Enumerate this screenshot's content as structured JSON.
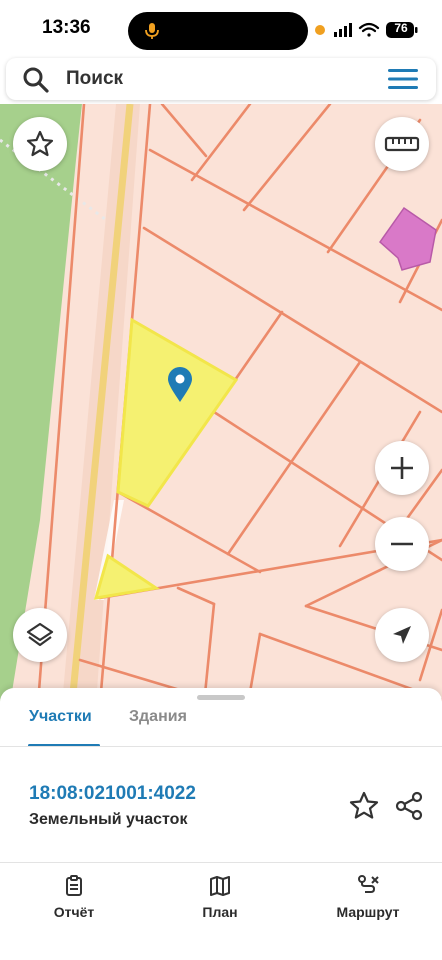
{
  "status_bar": {
    "time": "13:36",
    "battery": "76",
    "icons": [
      "microphone-icon",
      "recording-dot-icon",
      "signal-icon",
      "wifi-icon",
      "battery-icon"
    ]
  },
  "search": {
    "placeholder": "Поиск",
    "icons": [
      "search-icon",
      "menu-icon"
    ]
  },
  "map": {
    "controls": [
      "favorite-star-icon",
      "ruler-icon",
      "layers-icon",
      "zoom-in-icon",
      "zoom-out-icon",
      "locate-arrow-icon"
    ],
    "marker": "location-pin-icon",
    "colors": {
      "background": "#fbe2d7",
      "parcel_border": "#ec8a6a",
      "selected_parcel": "#f5f171",
      "forest": "#a6d08c",
      "road": "#f1d27b",
      "building": "#d979c8",
      "accent": "#1f7bb5"
    }
  },
  "sheet": {
    "tabs": [
      {
        "label": "Участки",
        "active": true
      },
      {
        "label": "Здания",
        "active": false
      }
    ],
    "parcel": {
      "number": "18:08:021001:4022",
      "type": "Земельный участок"
    },
    "actions": [
      "star-icon",
      "share-icon"
    ]
  },
  "bottom_nav": [
    {
      "label": "Отчёт",
      "icon": "report-icon"
    },
    {
      "label": "План",
      "icon": "map-plan-icon"
    },
    {
      "label": "Маршрут",
      "icon": "route-icon"
    }
  ]
}
